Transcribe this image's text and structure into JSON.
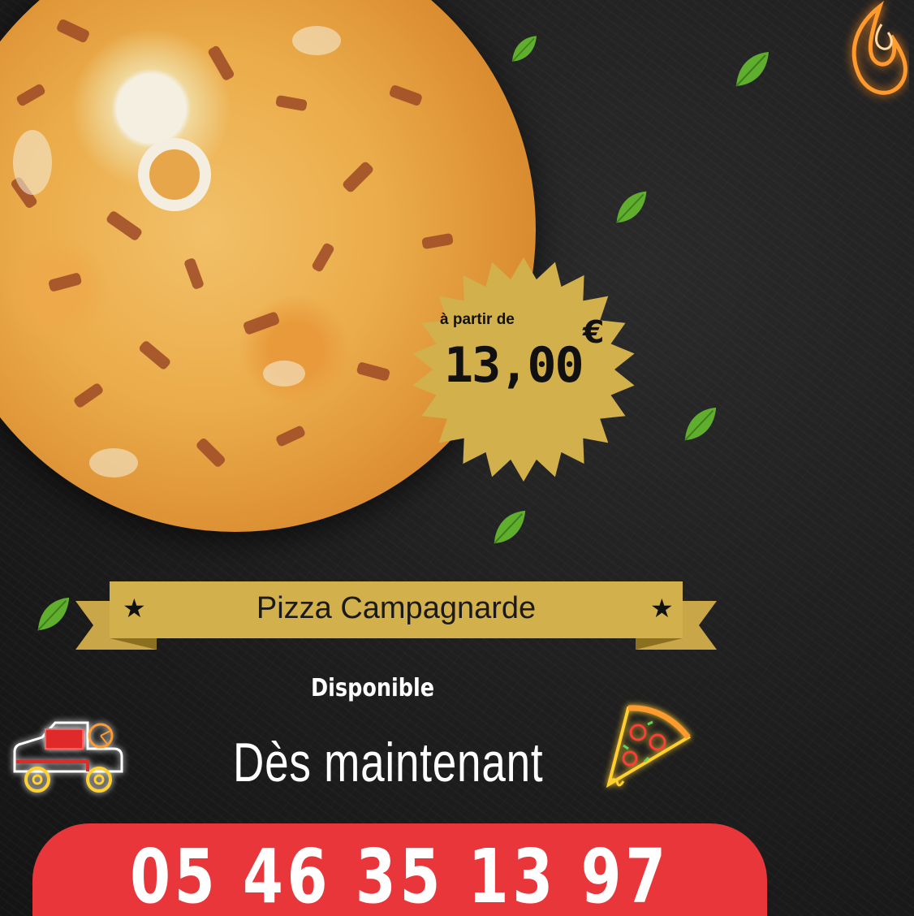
{
  "price": {
    "prefix": "à partir de",
    "value": "13,00",
    "currency": "€"
  },
  "banner": {
    "title": "Pizza Campagnarde",
    "star_left": "★",
    "star_right": "★"
  },
  "availability": {
    "label": "Disponible",
    "subtitle": "Dès maintenant"
  },
  "contact": {
    "phone": "05 46 35 13 97"
  },
  "colors": {
    "background": "#1c1c1c",
    "gold": "#d2b04c",
    "red": "#e8363b",
    "neon_orange": "#ff9a2e",
    "leaf_green": "#5fae2e"
  },
  "icons": [
    "flame-icon",
    "leaf-icon",
    "delivery-truck-icon",
    "pizza-slice-icon"
  ]
}
